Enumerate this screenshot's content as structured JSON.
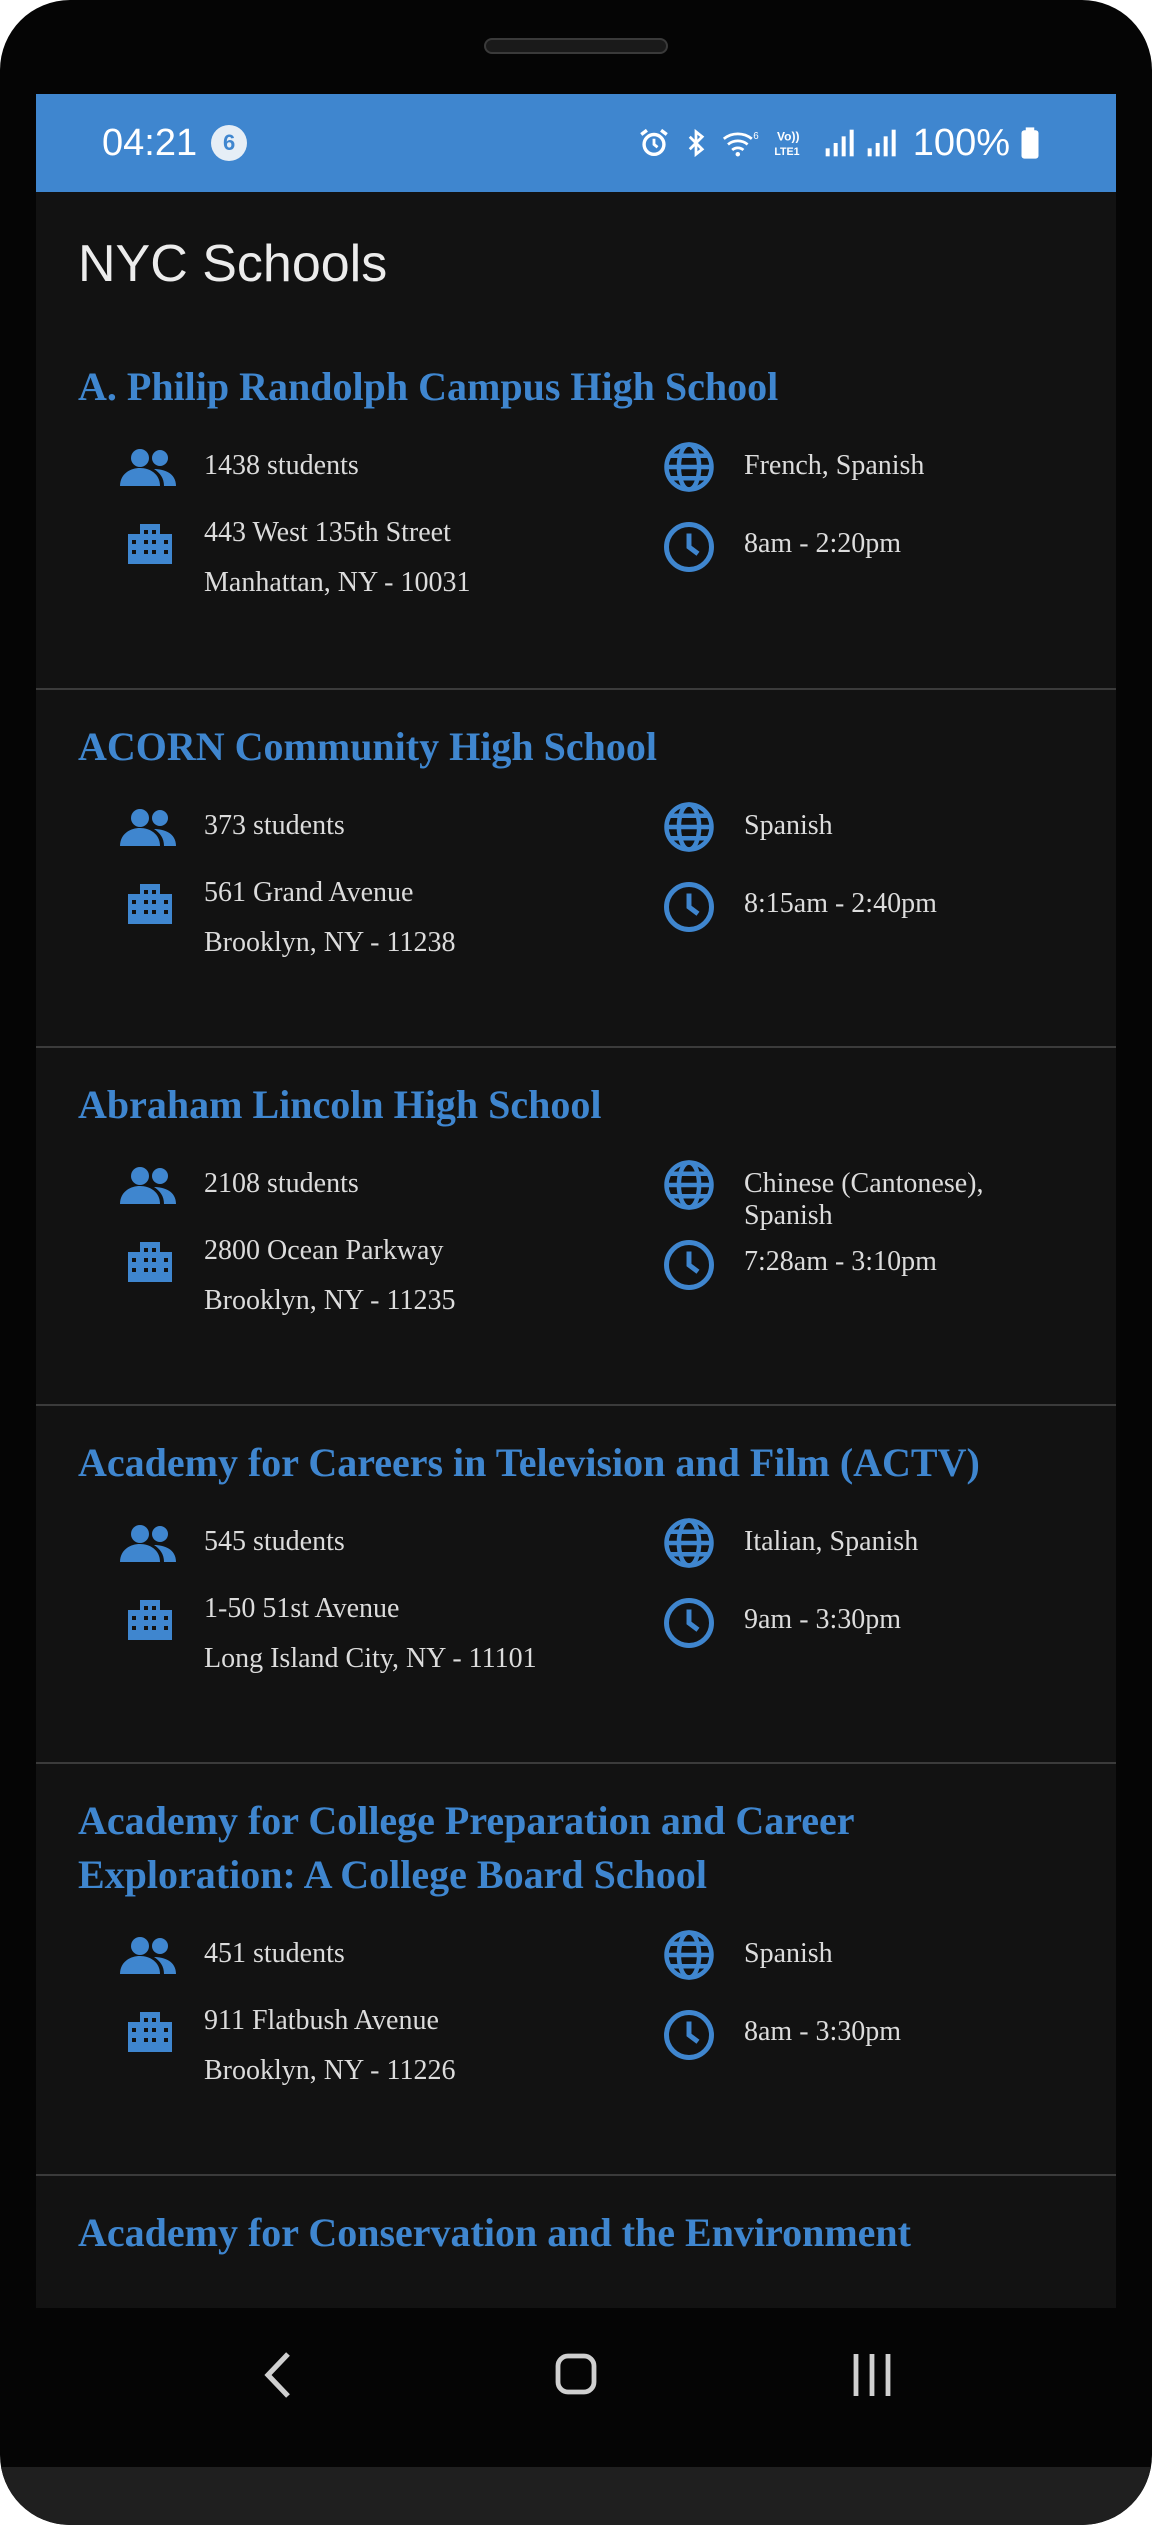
{
  "status_bar": {
    "time": "04:21",
    "notification_count": "6",
    "battery": "100%"
  },
  "app": {
    "title": "NYC Schools"
  },
  "schools": [
    {
      "name": "A. Philip Randolph Campus High School",
      "students": "1438 students",
      "address_line1": "443 West 135th Street",
      "address_line2": "Manhattan, NY - 10031",
      "languages": "French, Spanish",
      "hours": "8am - 2:20pm"
    },
    {
      "name": "ACORN Community High School",
      "students": "373 students",
      "address_line1": "561 Grand Avenue",
      "address_line2": "Brooklyn, NY - 11238",
      "languages": "Spanish",
      "hours": "8:15am - 2:40pm"
    },
    {
      "name": "Abraham Lincoln High School",
      "students": "2108 students",
      "address_line1": "2800 Ocean Parkway",
      "address_line2": "Brooklyn, NY - 11235",
      "languages": "Chinese (Cantonese), Spanish",
      "hours": "7:28am - 3:10pm"
    },
    {
      "name": "Academy for Careers in Television and Film (ACTV)",
      "students": "545 students",
      "address_line1": "1-50 51st Avenue",
      "address_line2": "Long Island City, NY - 11101",
      "languages": "Italian, Spanish",
      "hours": "9am - 3:30pm"
    },
    {
      "name_line1": "Academy for College Preparation and Career",
      "name_line2": "Exploration: A College Board School",
      "students": "451 students",
      "address_line1": "911 Flatbush Avenue",
      "address_line2": "Brooklyn, NY - 11226",
      "languages": "Spanish",
      "hours": "8am - 3:30pm"
    },
    {
      "name": "Academy for Conservation and the Environment"
    }
  ],
  "icons": {
    "students": "group-icon",
    "address": "building-icon",
    "languages": "globe-icon",
    "hours": "clock-icon"
  },
  "colors": {
    "accent": "#3f86cf",
    "background": "#121212",
    "text": "#dcdcdc"
  }
}
